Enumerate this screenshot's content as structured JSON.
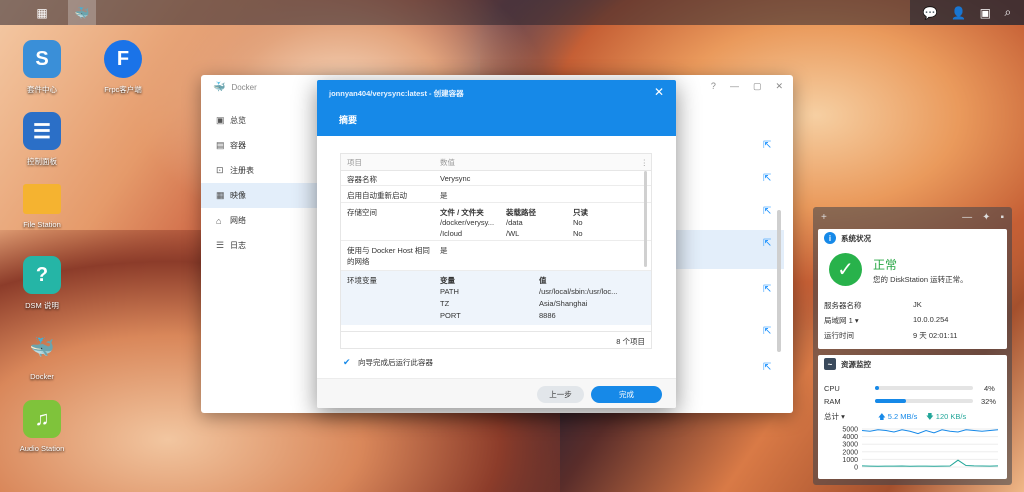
{
  "taskbar": {
    "tray": [
      "notification-icon",
      "user-icon",
      "widgets-icon",
      "search-icon"
    ]
  },
  "desktop_icons": [
    {
      "label": "套件中心",
      "icon": "package-center-icon",
      "glyph": "S",
      "color": "#3a8fd8"
    },
    {
      "label": "控制面板",
      "icon": "control-panel-icon",
      "glyph": "☰",
      "color": "#2b6fc7"
    },
    {
      "label": "File Station",
      "icon": "folder-icon",
      "glyph": "",
      "color": "#f5b330"
    },
    {
      "label": "DSM 说明",
      "icon": "help-icon",
      "glyph": "?",
      "color": "#25b5a6"
    },
    {
      "label": "Docker",
      "icon": "docker-icon",
      "glyph": "🐳",
      "color": "rgba(0,0,0,0)"
    },
    {
      "label": "Audio Station",
      "icon": "audio-station-icon",
      "glyph": "♫",
      "color": "#7fc33b"
    }
  ],
  "frpc_icon": {
    "label": "Frpc客户端",
    "glyph": "F",
    "color": "#1a73e8"
  },
  "docker_window": {
    "title": "Docker",
    "sidebar": [
      {
        "label": "总览",
        "icon": "overview-icon",
        "glyph": "▣"
      },
      {
        "label": "容器",
        "icon": "container-icon",
        "glyph": "▤"
      },
      {
        "label": "注册表",
        "icon": "registry-icon",
        "glyph": "⊡"
      },
      {
        "label": "映像",
        "icon": "image-icon",
        "glyph": "▦"
      },
      {
        "label": "网络",
        "icon": "network-icon",
        "glyph": "⌂"
      },
      {
        "label": "日志",
        "icon": "log-icon",
        "glyph": "☰"
      }
    ],
    "selected": "映像"
  },
  "dialog": {
    "title": "jonnyan404/verysync:latest - 创建容器",
    "step": "摘要",
    "table_header": {
      "item": "项目",
      "value": "数值"
    },
    "rows": {
      "name_key": "容器名称",
      "name_val": "Verysync",
      "autorestart_key": "启用自动重新启动",
      "autorestart_val": "是",
      "storage_key": "存储空间",
      "storage_cols": [
        "文件 / 文件夹",
        "装载路径",
        "只读"
      ],
      "storage_rows": [
        [
          "/docker/verysy...",
          "/data",
          "No"
        ],
        [
          "/Icloud",
          "/WL",
          "No"
        ]
      ],
      "network_key": "使用与 Docker Host 相同的网络",
      "network_val": "是",
      "env_key": "环境变量",
      "env_cols": [
        "变量",
        "值"
      ],
      "env_rows": [
        [
          "PATH",
          "/usr/local/sbin:/usr/loc..."
        ],
        [
          "TZ",
          "Asia/Shanghai"
        ],
        [
          "PORT",
          "8886"
        ]
      ]
    },
    "footer_count": "8 个项目",
    "checkbox_label": "向导完成后运行此容器",
    "back_button": "上一步",
    "done_button": "完成"
  },
  "widgets": {
    "system": {
      "title": "系统状况",
      "status": "正常",
      "desc": "您的 DiskStation 运转正常。",
      "rows": [
        [
          "服务器名称",
          "JK"
        ],
        [
          "局域网 1 ▾",
          "10.0.0.254"
        ],
        [
          "运行时间",
          "9 天 02:01:11"
        ]
      ]
    },
    "resource": {
      "title": "资源监控",
      "cpu_label": "CPU",
      "cpu_val": "4%",
      "cpu": 0.04,
      "ram_label": "RAM",
      "ram_val": "32%",
      "ram": 0.32,
      "total_label": "总计 ▾",
      "up": "5.2 MB/s",
      "down": "120 KB/s",
      "y_ticks": [
        "5000",
        "4000",
        "3000",
        "2000",
        "1000",
        "0"
      ]
    }
  },
  "chart_data": {
    "type": "line",
    "title": "",
    "y_ticks": [
      5000,
      4000,
      3000,
      2000,
      1000,
      0
    ],
    "ylim": [
      0,
      5000
    ],
    "series": [
      {
        "values": [
          4800,
          4700,
          4900,
          4800,
          4600,
          4900,
          4700,
          4400,
          4800,
          4500,
          4900,
          4700,
          4600,
          4900,
          4800,
          4700,
          4800,
          4900
        ]
      },
      {
        "values": [
          150,
          120,
          100,
          120,
          110,
          130,
          100,
          120,
          110,
          100,
          120,
          130,
          900,
          200,
          150,
          130,
          120,
          150
        ]
      }
    ]
  }
}
